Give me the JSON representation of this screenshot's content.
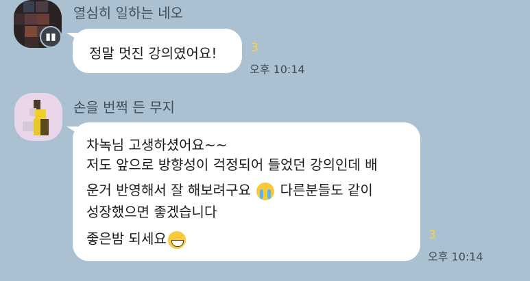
{
  "messages": [
    {
      "sender": "열심히 일하는 네오",
      "lines": [
        "정말 멋진 강의였어요!"
      ],
      "unread": "3",
      "time": "오후 10:14"
    },
    {
      "sender": "손을 번쩍 든 무지",
      "lines": [
        "차녹님 고생하셨어요~~",
        "저도 앞으로 방향성이 걱정되어 들었던 강의인데 배",
        "운거 반영해서 잘 해보려구요",
        "다른분들도 같이",
        "성장했으면 좋겠습니다",
        "좋은밤 되세요"
      ],
      "unread": "3",
      "time": "오후 10:14"
    }
  ],
  "icons": {
    "crying": "loudly-crying-face-emoji",
    "grin": "grinning-face-emoji",
    "badge": "profile-badge-icon"
  },
  "colors": {
    "background": "#abc1d1",
    "bubble": "#ffffff",
    "unread": "#f5d735"
  }
}
